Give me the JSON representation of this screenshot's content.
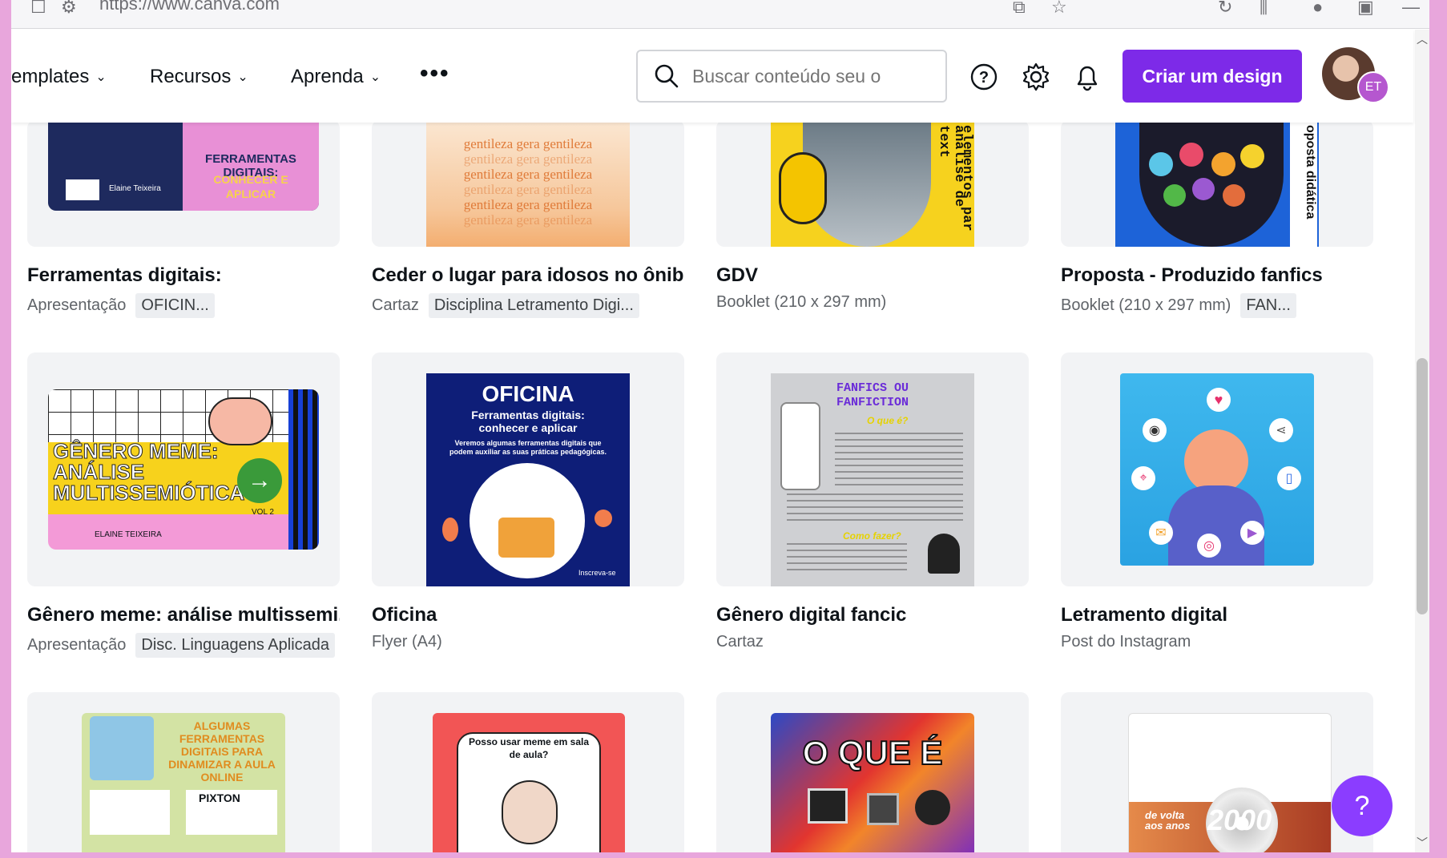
{
  "browser": {
    "url": "https://www.canva.com"
  },
  "nav": {
    "items": [
      {
        "label": "emplates"
      },
      {
        "label": "Recursos"
      },
      {
        "label": "Aprenda"
      }
    ],
    "more": "•••"
  },
  "search": {
    "placeholder": "Buscar conteúdo seu o"
  },
  "toolbar": {
    "create_label": "Criar um design"
  },
  "user": {
    "initials": "ET"
  },
  "help": {
    "label": "?"
  },
  "colors": {
    "accent": "#7d2ae8",
    "help": "#8b3dff",
    "badge": "#b557cf"
  },
  "designs": [
    {
      "title": "Ferramentas digitais:",
      "type": "Apresentação",
      "tag": "OFICIN...",
      "img_text": [
        "FERRAMENTAS DIGITAIS:",
        "CONHECER E",
        "APLICAR",
        "Elaine Teixeira"
      ]
    },
    {
      "title": "Ceder o lugar para idosos no ônib...",
      "type": "Cartaz",
      "tag": "Disciplina Letramento Digi...",
      "img_text": [
        "gentileza gera gentileza"
      ]
    },
    {
      "title": "GDV",
      "type": "Booklet (210 x 297 mm)",
      "tag": "",
      "img_text": [
        "elementos par",
        "análise de text"
      ]
    },
    {
      "title": "Proposta - Produzido fanfics",
      "type": "Booklet (210 x 297 mm)",
      "tag": "FAN...",
      "img_text": [
        "oposta didática"
      ]
    },
    {
      "title": "Gênero meme: análise multissemi...",
      "type": "Apresentação",
      "tag": "Disc. Linguagens Aplicada",
      "img_text": [
        "GÊNERO MEME:",
        "ANÁLISE",
        "MULTISSEMIÓTICA",
        "VOL 2",
        "ELAINE TEIXEIRA"
      ]
    },
    {
      "title": "Oficina",
      "type": "Flyer (A4)",
      "tag": "",
      "img_text": [
        "OFICINA",
        "Ferramentas digitais:",
        "conhecer e aplicar",
        "Veremos algumas ferramentas digitais que podem auxiliar as suas práticas pedagógicas.",
        "Inscreva-se"
      ]
    },
    {
      "title": "Gênero digital fancic",
      "type": "Cartaz",
      "tag": "",
      "img_text": [
        "FANFICS OU",
        "FANFICTION",
        "O que é?",
        "Como fazer?"
      ]
    },
    {
      "title": "Letramento digital",
      "type": "Post do Instagram",
      "tag": "",
      "img_text": []
    },
    {
      "title": "",
      "type": "",
      "tag": "",
      "img_text": [
        "ALGUMAS",
        "FERRAMENTAS",
        "DIGITAIS PARA",
        "DINAMIZAR A AULA",
        "ONLINE",
        "PIXTON"
      ]
    },
    {
      "title": "",
      "type": "",
      "tag": "",
      "img_text": [
        "Posso usar meme em sala",
        "de aula?"
      ]
    },
    {
      "title": "",
      "type": "",
      "tag": "",
      "img_text": [
        "O QUE É"
      ]
    },
    {
      "title": "",
      "type": "",
      "tag": "",
      "img_text": [
        "de volta",
        "aos anos",
        "2000"
      ]
    }
  ]
}
